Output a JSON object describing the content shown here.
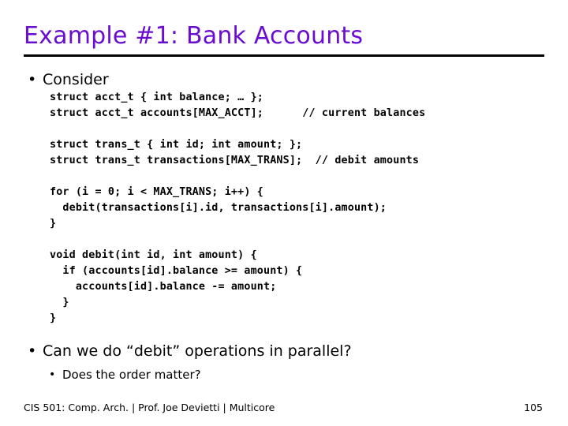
{
  "slide": {
    "title": "Example #1: Bank Accounts",
    "title_color": "#6A0DD0",
    "rule_color": "#000000",
    "background": "#ffffff"
  },
  "bullets": {
    "first": "Consider",
    "second": "Can we do “debit” operations in parallel?",
    "sub": "Does the order matter?",
    "glyph": "•"
  },
  "code": {
    "group1": "struct acct_t { int balance; … };\nstruct acct_t accounts[MAX_ACCT];      // current balances",
    "group2": "struct trans_t { int id; int amount; };\nstruct trans_t transactions[MAX_TRANS];  // debit amounts",
    "group3": "for (i = 0; i < MAX_TRANS; i++) {\n  debit(transactions[i].id, transactions[i].amount);\n}",
    "group4": "void debit(int id, int amount) {\n  if (accounts[id].balance >= amount) {\n    accounts[id].balance -= amount;\n  }\n}"
  },
  "footer": {
    "text": "CIS 501: Comp. Arch.  |  Prof. Joe Devietti  |  Multicore",
    "page_number": "105"
  }
}
